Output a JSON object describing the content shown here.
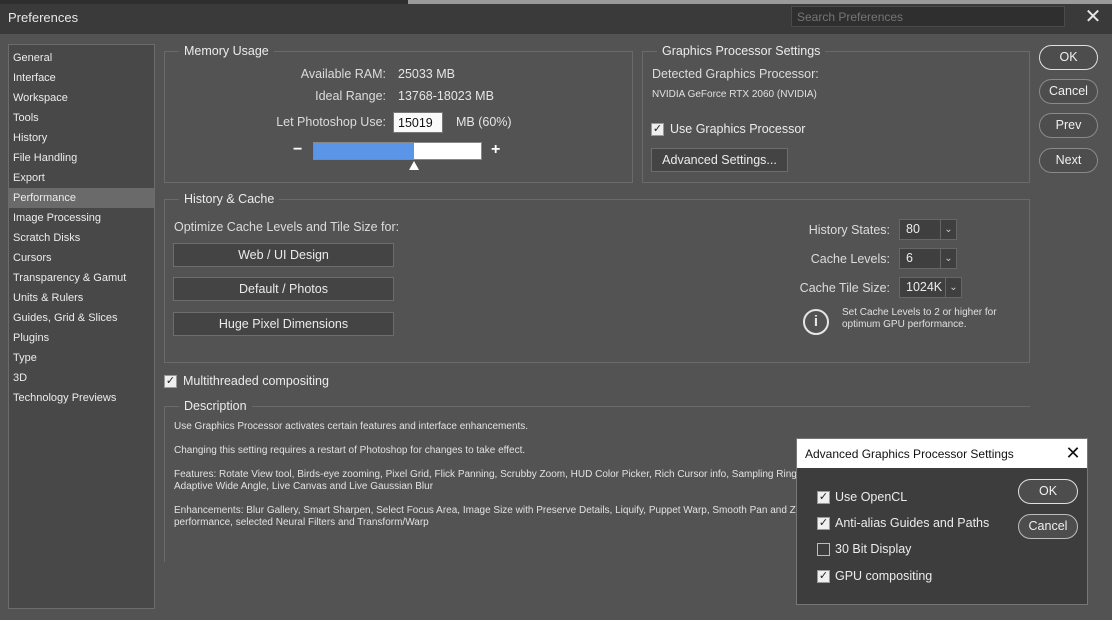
{
  "window": {
    "title": "Preferences",
    "search_placeholder": "Search Preferences"
  },
  "sidebar": {
    "items": [
      {
        "label": "General"
      },
      {
        "label": "Interface"
      },
      {
        "label": "Workspace"
      },
      {
        "label": "Tools"
      },
      {
        "label": "History"
      },
      {
        "label": "File Handling"
      },
      {
        "label": "Export"
      },
      {
        "label": "Performance",
        "active": true
      },
      {
        "label": "Image Processing"
      },
      {
        "label": "Scratch Disks"
      },
      {
        "label": "Cursors"
      },
      {
        "label": "Transparency & Gamut"
      },
      {
        "label": "Units & Rulers"
      },
      {
        "label": "Guides, Grid & Slices"
      },
      {
        "label": "Plugins"
      },
      {
        "label": "Type"
      },
      {
        "label": "3D"
      },
      {
        "label": "Technology Previews"
      }
    ]
  },
  "memory": {
    "legend": "Memory Usage",
    "available_label": "Available RAM:",
    "available_value": "25033 MB",
    "ideal_label": "Ideal Range:",
    "ideal_value": "13768-18023 MB",
    "use_label": "Let Photoshop Use:",
    "use_value": "15019",
    "use_suffix": "MB (60%)",
    "minus": "−",
    "plus": "+",
    "slider_fraction": 0.6
  },
  "gpu": {
    "legend": "Graphics Processor Settings",
    "detected_label": "Detected Graphics Processor:",
    "detected_value": "NVIDIA GeForce RTX 2060 (NVIDIA)",
    "use_gpu_label": "Use Graphics Processor",
    "use_gpu_checked": true,
    "advanced_button": "Advanced Settings..."
  },
  "history_cache": {
    "legend": "History & Cache",
    "optimize_label": "Optimize Cache Levels and Tile Size for:",
    "buttons": [
      "Web / UI Design",
      "Default / Photos",
      "Huge Pixel Dimensions"
    ],
    "history_states_label": "History States:",
    "history_states_value": "80",
    "cache_levels_label": "Cache Levels:",
    "cache_levels_value": "6",
    "tile_size_label": "Cache Tile Size:",
    "tile_size_value": "1024K",
    "info_line1": "Set Cache Levels to 2 or higher for",
    "info_line2": "optimum GPU performance."
  },
  "multithreaded": {
    "label": "Multithreaded compositing",
    "checked": true
  },
  "description": {
    "legend": "Description",
    "line1": "Use Graphics Processor activates certain features and interface enhancements.",
    "line2": "Changing this setting requires a restart of Photoshop for changes to take effect.",
    "line3": "Features: Rotate View tool, Birds-eye zooming, Pixel Grid, Flick Panning, Scrubby Zoom, HUD Color Picker, Rich Cursor info, Sampling Ring",
    "line4": "Adaptive Wide Angle, Live Canvas and Live Gaussian Blur",
    "line5": "Enhancements: Blur Gallery, Smart Sharpen, Select Focus Area, Image Size with Preserve Details, Liquify, Puppet Warp, Smooth Pan and Z",
    "line6": "performance, selected Neural Filters and Transform/Warp"
  },
  "actions": {
    "ok": "OK",
    "cancel": "Cancel",
    "prev": "Prev",
    "next": "Next"
  },
  "advanced_dialog": {
    "title": "Advanced Graphics Processor Settings",
    "ok": "OK",
    "cancel": "Cancel",
    "options": [
      {
        "label": "Use OpenCL",
        "checked": true
      },
      {
        "label": "Anti-alias Guides and Paths",
        "checked": true
      },
      {
        "label": "30 Bit Display",
        "checked": false
      },
      {
        "label": "GPU compositing",
        "checked": true
      }
    ]
  },
  "colors": {
    "background": "#535353",
    "slider_fill": "#5b95e8",
    "active_item": "#6a6a6a"
  }
}
